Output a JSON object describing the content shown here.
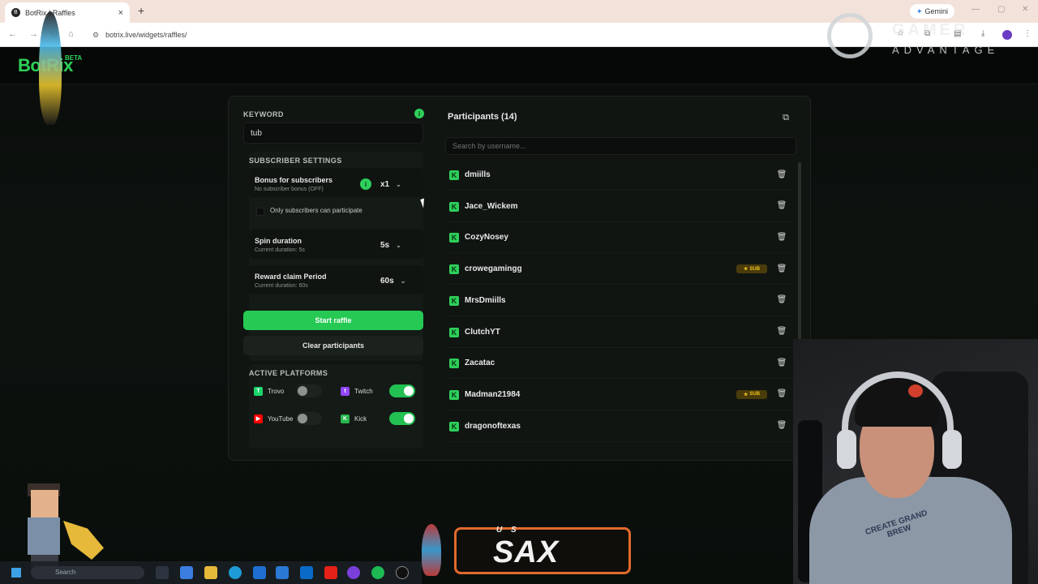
{
  "browser": {
    "tab_title": "BotRix | Raffles",
    "tab_close": "×",
    "new_tab": "+",
    "url": "botrix.live/widgets/raffles/",
    "gemini_label": "Gemini"
  },
  "site": {
    "logo": "BotRix",
    "beta": "BETA"
  },
  "overlay": {
    "brand_top": "GAMER",
    "brand_bottom": "ADVANTAGE"
  },
  "keyword": {
    "label": "KEYWORD",
    "info": "i",
    "value": "tub"
  },
  "subscriber_settings": {
    "title": "SUBSCRIBER SETTINGS",
    "bonus_label": "Bonus for subscribers",
    "bonus_sub": "No subscriber bonus (OFF)",
    "bonus_info": "i",
    "bonus_value": "x1",
    "only_subs_label": "Only subscribers can participate",
    "only_subs_checked": false,
    "spin_label": "Spin duration",
    "spin_sub": "Current duration: 5s",
    "spin_value": "5s",
    "reward_label": "Reward claim Period",
    "reward_sub": "Current duration: 60s",
    "reward_value": "60s"
  },
  "actions": {
    "start": "Start raffle",
    "clear": "Clear participants"
  },
  "platforms": {
    "title": "ACTIVE PLATFORMS",
    "items": [
      {
        "name": "Trovo",
        "enabled": false,
        "color": "#19d66b"
      },
      {
        "name": "Twitch",
        "enabled": true,
        "color": "#9146ff"
      },
      {
        "name": "YouTube",
        "enabled": false,
        "color": "#ff0000"
      },
      {
        "name": "Kick",
        "enabled": true,
        "color": "#53fc18"
      }
    ]
  },
  "participants": {
    "title": "Participants (14)",
    "search_placeholder": "Search by username...",
    "sub_badge": "SUB",
    "kick_glyph": "K",
    "list": [
      {
        "name": "dmiills",
        "sub": false
      },
      {
        "name": "Jace_Wickem",
        "sub": false
      },
      {
        "name": "CozyNosey",
        "sub": false
      },
      {
        "name": "crowegamingg",
        "sub": true
      },
      {
        "name": "MrsDmiills",
        "sub": false
      },
      {
        "name": "ClutchYT",
        "sub": false
      },
      {
        "name": "Zacatac",
        "sub": false
      },
      {
        "name": "Madman21984",
        "sub": true
      },
      {
        "name": "dragonoftexas",
        "sub": false
      }
    ]
  },
  "stream_overlay": {
    "sax_small": "U S",
    "sax_big": "SAX",
    "hoodie_print": "CREATE GRAND BREW"
  },
  "taskbar": {
    "search": "Search"
  }
}
